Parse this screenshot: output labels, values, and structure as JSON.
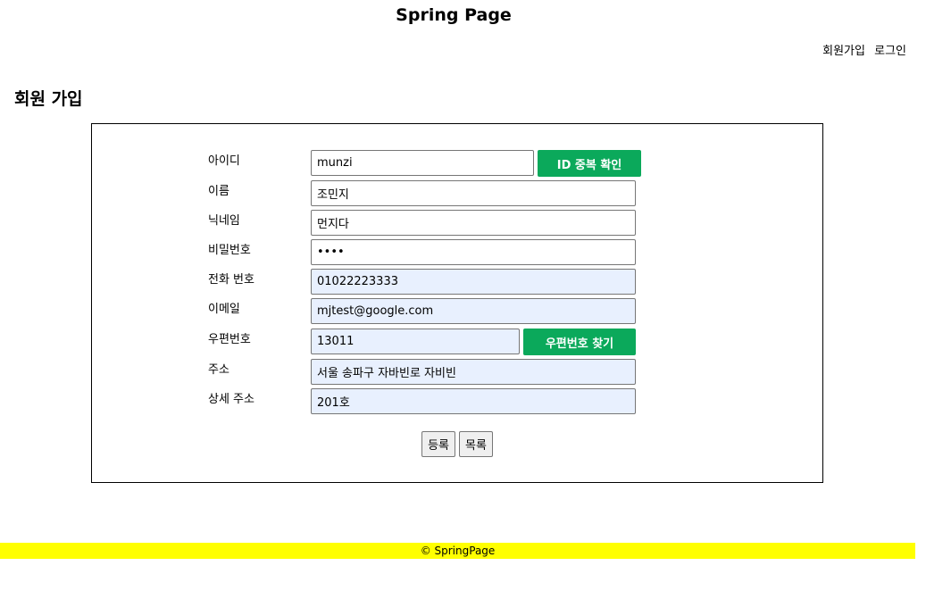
{
  "header": {
    "title": "Spring Page",
    "nav": {
      "signup": "회원가입",
      "login": "로그인"
    }
  },
  "section_title": "회원 가입",
  "form": {
    "fields": {
      "userid": {
        "label": "아이디",
        "value": "munzi"
      },
      "name": {
        "label": "이름",
        "value": "조민지"
      },
      "nickname": {
        "label": "닉네임",
        "value": "먼지다"
      },
      "password": {
        "label": "비밀번호",
        "value": "1234"
      },
      "phone": {
        "label": "전화 번호",
        "value": "01022223333"
      },
      "email": {
        "label": "이메일",
        "value": "mjtest@google.com"
      },
      "zipcode": {
        "label": "우편번호",
        "value": "13011"
      },
      "address": {
        "label": "주소",
        "value": "서울 송파구 자바빈로 자비빈"
      },
      "address_detail": {
        "label": "상세 주소",
        "value": "201호"
      }
    },
    "id_check_button": "ID 중복 확인",
    "zip_search_button": "우편번호 찾기",
    "submit_button": "등록",
    "list_button": "목록"
  },
  "footer": {
    "text": "© SpringPage"
  },
  "colors": {
    "accent_green": "#0ba95b",
    "footer_yellow": "#ffff00",
    "autofill_blue": "#e8f0fe"
  }
}
